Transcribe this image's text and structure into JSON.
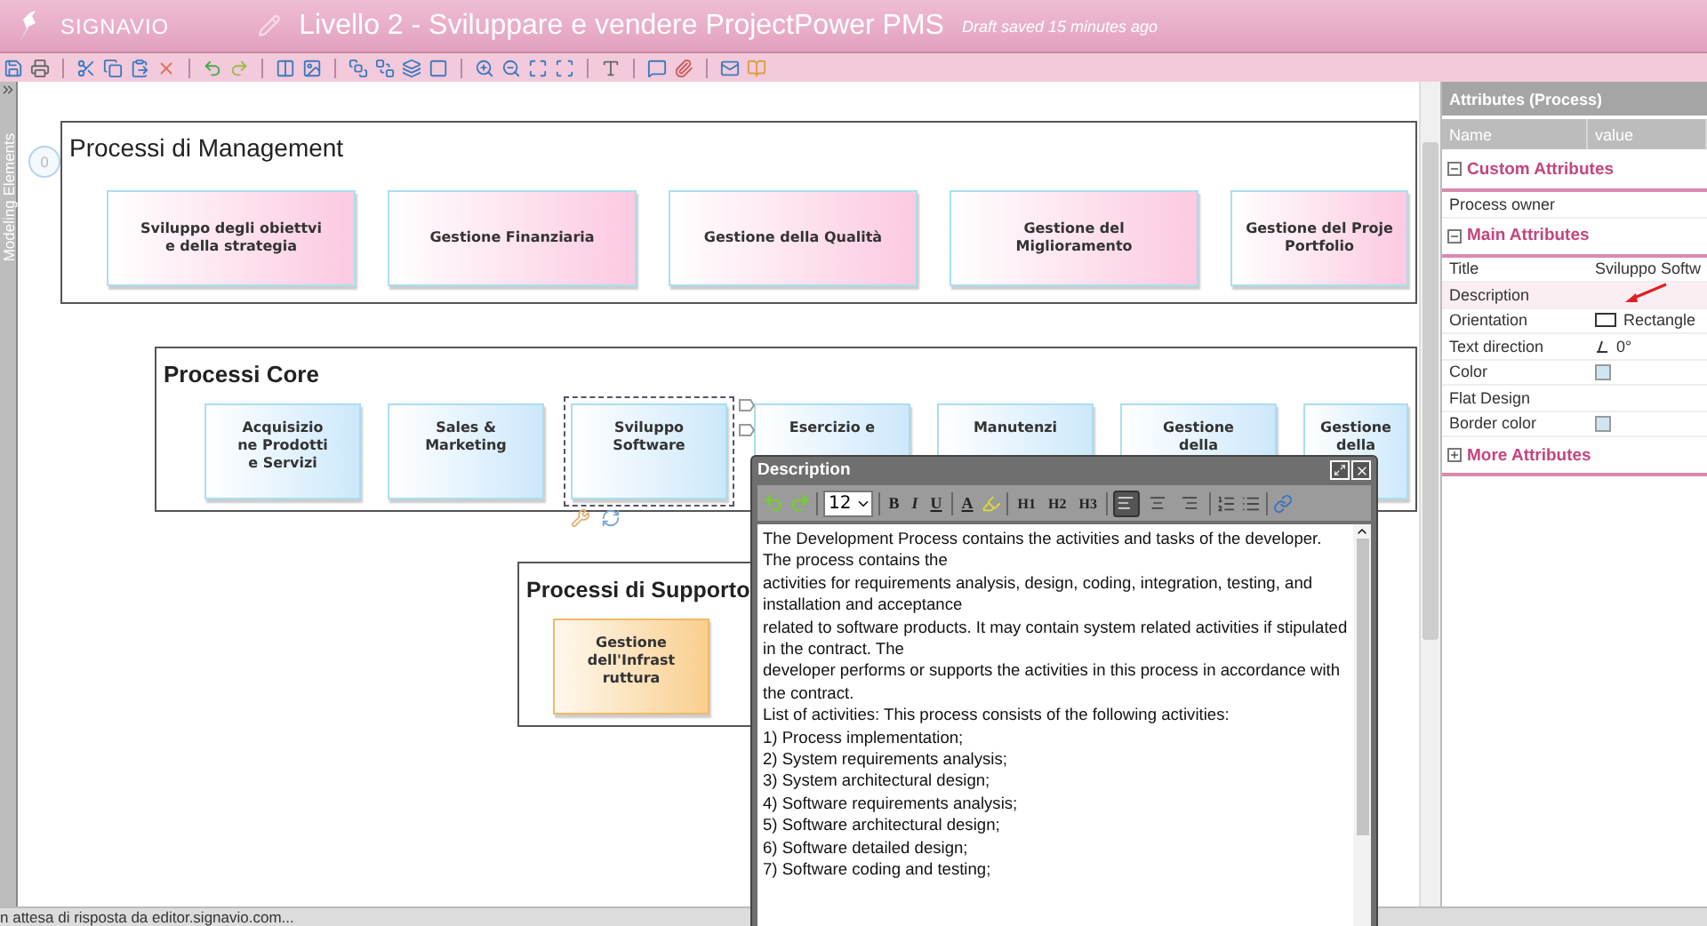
{
  "header": {
    "brand": "SIGNAVIO",
    "title": "Livello 2 - Sviluppare e vendere ProjectPower PMS",
    "draft_status": "Draft saved 15 minutes ago"
  },
  "side_tab": {
    "label": "Modeling Elements"
  },
  "canvas": {
    "comment_count": "0",
    "pools": [
      {
        "kind": "management",
        "title": "Processi di Management",
        "nodes": [
          {
            "label": "Sviluppo degli obiettvi\ne della strategia",
            "selected": false
          },
          {
            "label": "Gestione Finanziaria",
            "selected": false
          },
          {
            "label": "Gestione della Qualità",
            "selected": false
          },
          {
            "label": "Gestione del\nMiglioramento",
            "selected": false
          },
          {
            "label": "Gestione del Proje\nPortfolio",
            "selected": false
          }
        ]
      },
      {
        "kind": "core",
        "title": "Processi Core",
        "nodes": [
          {
            "label": "Acquisizio\nne Prodotti\ne Servizi",
            "selected": false
          },
          {
            "label": "Sales &\nMarketing",
            "selected": false
          },
          {
            "label": "Sviluppo\nSoftware",
            "selected": true
          },
          {
            "label": "Esercizio e",
            "selected": false
          },
          {
            "label": "Manutenzi",
            "selected": false
          },
          {
            "label": "Gestione\ndella",
            "selected": false
          },
          {
            "label": "Gestione\ndella",
            "selected": false
          }
        ]
      },
      {
        "kind": "support",
        "title": "Processi di Supporto",
        "nodes": [
          {
            "label": "Gestione\ndell'Infrast\nruttura",
            "selected": false
          }
        ]
      }
    ]
  },
  "description_dialog": {
    "title": "Description",
    "font_size": "12",
    "format_buttons": [
      "B",
      "I",
      "U"
    ],
    "color_button": "A",
    "heading_buttons": [
      "H1",
      "H2",
      "H3"
    ],
    "align_buttons": [
      {
        "kind": "left",
        "selected": true
      },
      {
        "kind": "center",
        "selected": false
      },
      {
        "kind": "right",
        "selected": false
      }
    ],
    "paragraphs": [
      "The Development Process contains the activities and tasks of the developer. The process contains the",
      "activities for requirements analysis, design, coding, integration, testing, and installation and acceptance",
      "related to software products. It may contain system related activities if stipulated in the contract. The",
      "developer performs or supports the activities in this process in accordance with the contract.",
      "List of activities: This process consists of the following activities:",
      "1) Process implementation;",
      "2) System requirements analysis;",
      "3) System architectural design;",
      "4) Software requirements analysis;",
      "5) Software architectural design;",
      "6) Software detailed design;",
      "7) Software coding and testing;"
    ]
  },
  "attributes_panel": {
    "title": "Attributes (Process)",
    "columns": [
      "Name",
      "value"
    ],
    "sections": [
      {
        "title": "Custom Attributes",
        "expanded": true,
        "rows": [
          {
            "name": "Process owner",
            "kind": "empty",
            "selected": false
          }
        ]
      },
      {
        "title": "Main Attributes",
        "expanded": true,
        "rows": [
          {
            "name": "Title",
            "kind": "text",
            "value": "Sviluppo Softw",
            "selected": false
          },
          {
            "name": "Description",
            "kind": "empty",
            "selected": true
          },
          {
            "name": "Orientation",
            "kind": "shape",
            "value": "Rectangle",
            "selected": false
          },
          {
            "name": "Text direction",
            "kind": "angle",
            "value": "0°",
            "selected": false
          },
          {
            "name": "Color",
            "kind": "swatch",
            "color": "#cfe6f2",
            "selected": false
          },
          {
            "name": "Flat Design",
            "kind": "empty",
            "selected": false
          },
          {
            "name": "Border color",
            "kind": "swatch",
            "color": "#cfe6f2",
            "selected": false
          }
        ]
      },
      {
        "title": "More Attributes",
        "expanded": false
      }
    ]
  },
  "status_bar": {
    "text": "n attesa di risposta da editor.signavio.com..."
  }
}
